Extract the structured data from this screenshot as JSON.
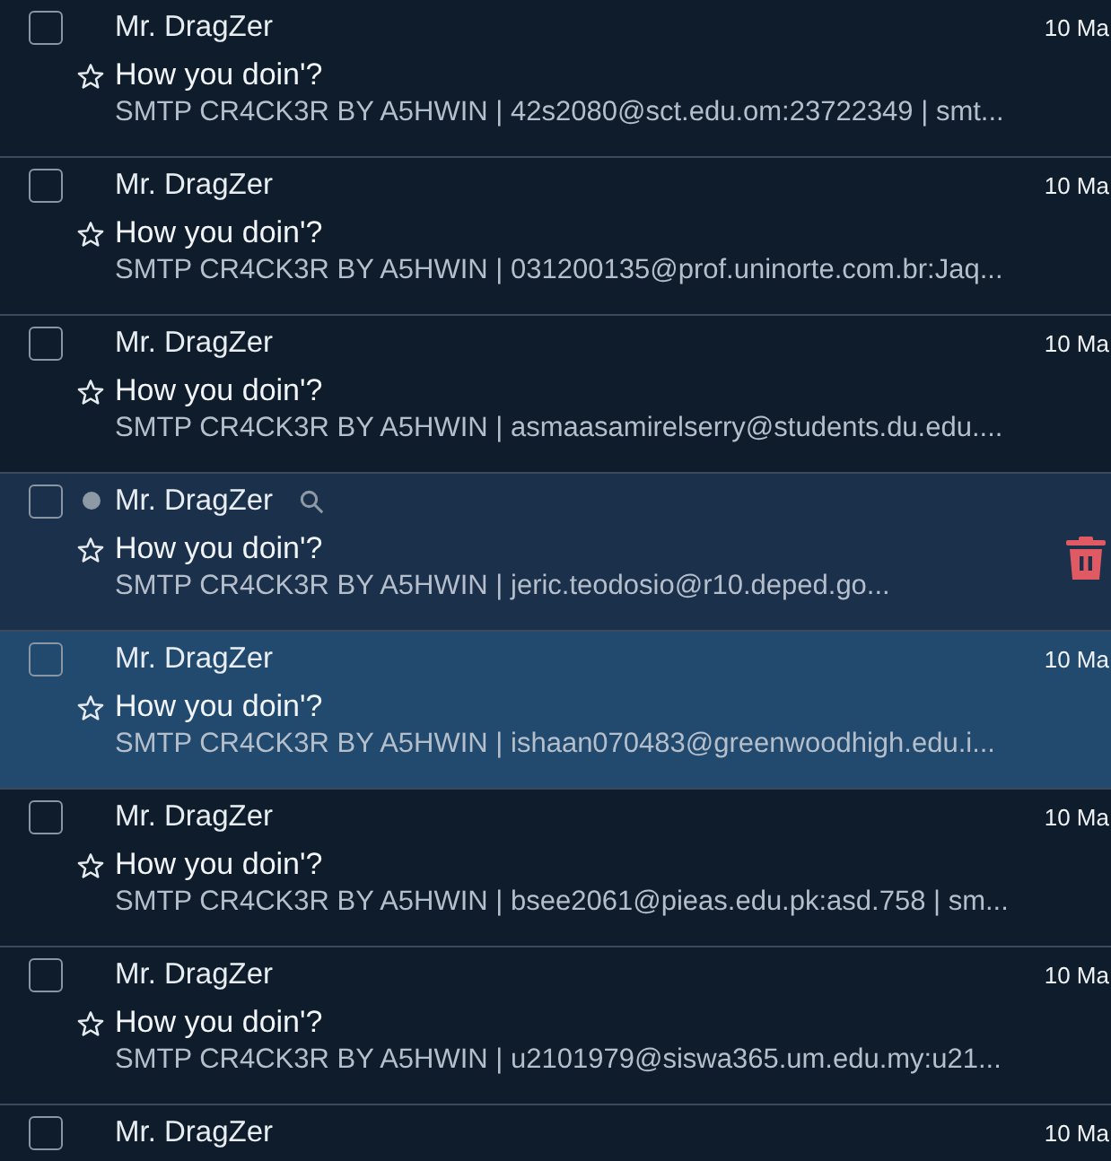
{
  "messages": [
    {
      "sender": "Mr. DragZer",
      "date": "10 Ma",
      "subject": "How you doin'?",
      "snippet": "SMTP CR4CK3R BY A5HWIN | 42s2080@sct.edu.om:23722349 | smt...",
      "checked": false,
      "starred": false,
      "selected": false,
      "hovered": false
    },
    {
      "sender": "Mr. DragZer",
      "date": "10 Ma",
      "subject": "How you doin'?",
      "snippet": "SMTP CR4CK3R BY A5HWIN | 031200135@prof.uninorte.com.br:Jaq...",
      "checked": false,
      "starred": false,
      "selected": false,
      "hovered": false
    },
    {
      "sender": "Mr. DragZer",
      "date": "10 Ma",
      "subject": "How you doin'?",
      "snippet": "SMTP CR4CK3R BY A5HWIN | asmaasamirelserry@students.du.edu....",
      "checked": false,
      "starred": false,
      "selected": false,
      "hovered": false
    },
    {
      "sender": "Mr. DragZer",
      "subject": "How you doin'?",
      "snippet": "SMTP CR4CK3R BY A5HWIN | jeric.teodosio@r10.deped.go...",
      "checked": false,
      "starred": false,
      "selected": false,
      "hovered": true
    },
    {
      "sender": "Mr. DragZer",
      "date": "10 Ma",
      "subject": "How you doin'?",
      "snippet": "SMTP CR4CK3R BY A5HWIN | ishaan070483@greenwoodhigh.edu.i...",
      "checked": false,
      "starred": false,
      "selected": true,
      "hovered": false
    },
    {
      "sender": "Mr. DragZer",
      "date": "10 Ma",
      "subject": "How you doin'?",
      "snippet": "SMTP CR4CK3R BY A5HWIN | bsee2061@pieas.edu.pk:asd.758 | sm...",
      "checked": false,
      "starred": false,
      "selected": false,
      "hovered": false
    },
    {
      "sender": "Mr. DragZer",
      "date": "10 Ma",
      "subject": "How you doin'?",
      "snippet": "SMTP CR4CK3R BY A5HWIN | u2101979@siswa365.um.edu.my:u21...",
      "checked": false,
      "starred": false,
      "selected": false,
      "hovered": false
    },
    {
      "sender": "Mr. DragZer",
      "date": "10 Ma",
      "checked": false,
      "selected": false,
      "hovered": false
    }
  ]
}
